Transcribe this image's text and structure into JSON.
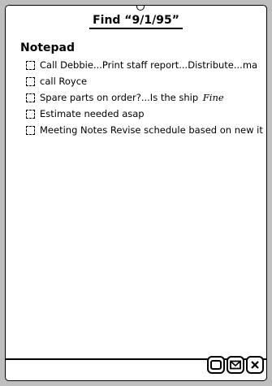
{
  "window": {
    "title": "Find “9/1/95”"
  },
  "section": {
    "title": "Notepad"
  },
  "results": [
    {
      "text": "Call Debbie...Print staff report...Distribute...ma",
      "ink": ""
    },
    {
      "text": "call Royce",
      "ink": ""
    },
    {
      "text": "Spare parts on order?...Is the ship",
      "ink": "Fine"
    },
    {
      "text": "Estimate needed asap",
      "ink": ""
    },
    {
      "text": "Meeting Notes Revise schedule based on new it",
      "ink": ""
    }
  ],
  "buttons": [
    {
      "icon": "overview-icon"
    },
    {
      "icon": "envelope-icon"
    },
    {
      "icon": "close-icon"
    }
  ]
}
